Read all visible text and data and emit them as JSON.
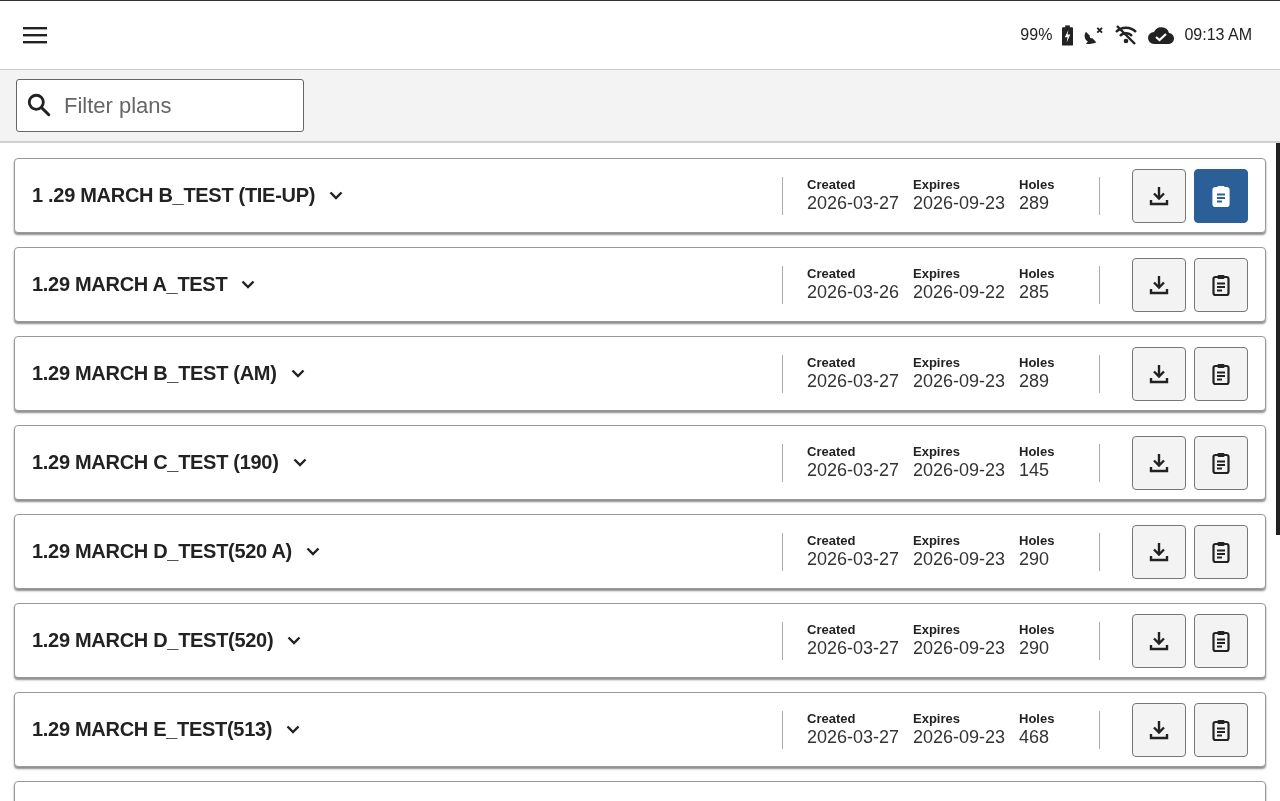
{
  "status_bar": {
    "battery": "99%",
    "time": "09:13 AM"
  },
  "filter": {
    "placeholder": "Filter plans"
  },
  "plans": [
    {
      "name": "1 .29 MARCH B_TEST (TIE-UP)",
      "created_label": "Created",
      "created": "2026-03-27",
      "expires_label": "Expires",
      "expires": "2026-09-23",
      "holes_label": "Holes",
      "holes": "289",
      "selected": true
    },
    {
      "name": "1.29 MARCH A_TEST",
      "created_label": "Created",
      "created": "2026-03-26",
      "expires_label": "Expires",
      "expires": "2026-09-22",
      "holes_label": "Holes",
      "holes": "285",
      "selected": false
    },
    {
      "name": "1.29 MARCH B_TEST (AM)",
      "created_label": "Created",
      "created": "2026-03-27",
      "expires_label": "Expires",
      "expires": "2026-09-23",
      "holes_label": "Holes",
      "holes": "289",
      "selected": false
    },
    {
      "name": "1.29 MARCH C_TEST (190)",
      "created_label": "Created",
      "created": "2026-03-27",
      "expires_label": "Expires",
      "expires": "2026-09-23",
      "holes_label": "Holes",
      "holes": "145",
      "selected": false
    },
    {
      "name": "1.29 MARCH D_TEST(520 A)",
      "created_label": "Created",
      "created": "2026-03-27",
      "expires_label": "Expires",
      "expires": "2026-09-23",
      "holes_label": "Holes",
      "holes": "290",
      "selected": false
    },
    {
      "name": "1.29 MARCH D_TEST(520)",
      "created_label": "Created",
      "created": "2026-03-27",
      "expires_label": "Expires",
      "expires": "2026-09-23",
      "holes_label": "Holes",
      "holes": "290",
      "selected": false
    },
    {
      "name": "1.29 MARCH E_TEST(513)",
      "created_label": "Created",
      "created": "2026-03-27",
      "expires_label": "Expires",
      "expires": "2026-09-23",
      "holes_label": "Holes",
      "holes": "468",
      "selected": false
    }
  ],
  "more_below": true
}
